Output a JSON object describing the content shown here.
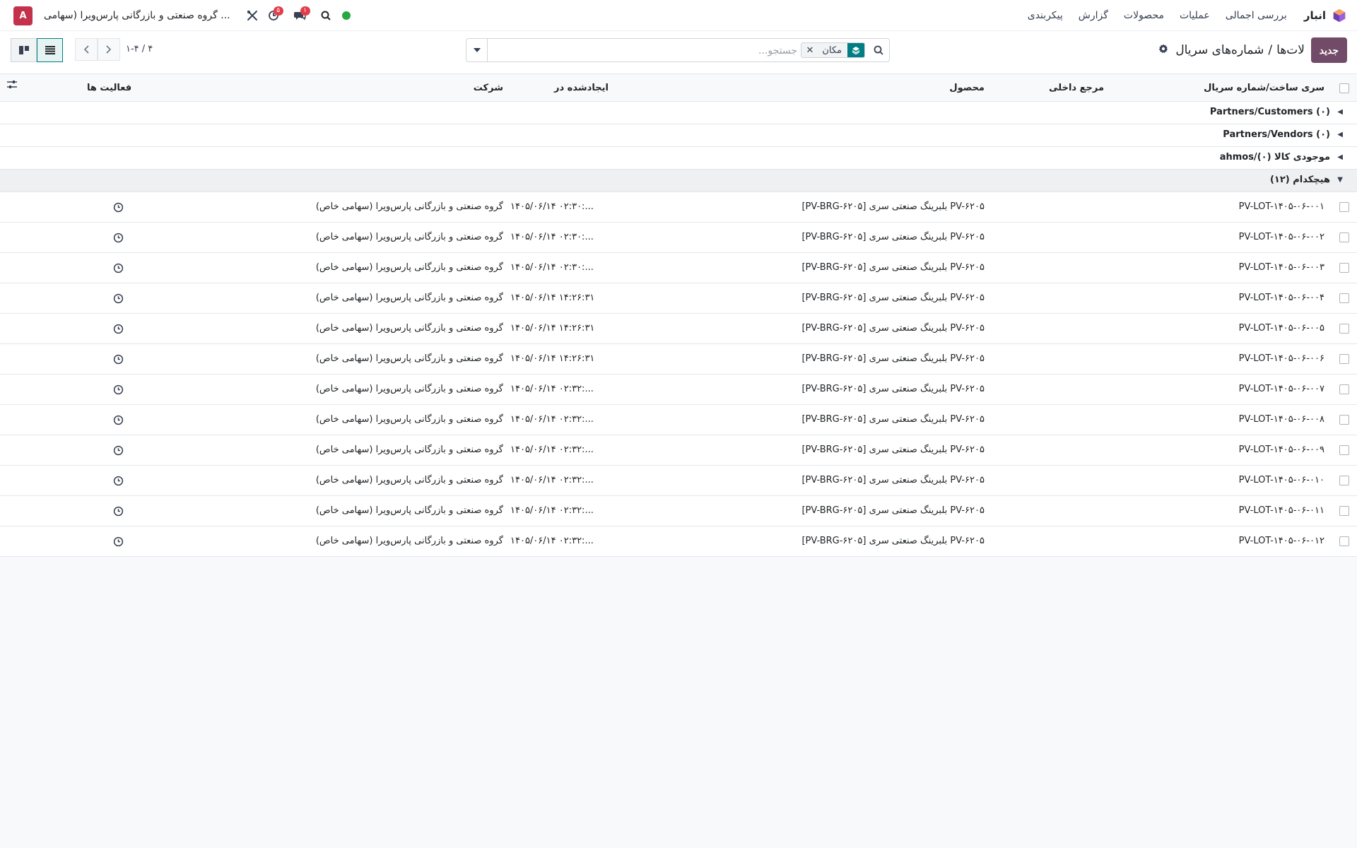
{
  "topbar": {
    "app_name": "انبار",
    "menu": [
      "بررسی اجمالی",
      "عملیات",
      "محصولات",
      "گزارش",
      "پیکربندی"
    ],
    "company": "گروه صنعتی و بازرگانی پارس‌ویرا (سهامی ...",
    "avatar_letter": "A",
    "activity_badge": "۵",
    "messages_badge": "۱",
    "status_color": "#28a745"
  },
  "control": {
    "new_button": "جدید",
    "breadcrumb_parent": "لات‌ها",
    "breadcrumb_sep": "/",
    "breadcrumb_current": "شماره‌های سریال",
    "search_facet": "مکان",
    "search_placeholder": "جستجو...",
    "pager": "۱-۴ / ۴"
  },
  "table": {
    "headers": {
      "lot": "سری ساخت/شماره سریال",
      "ref": "مرجع داخلی",
      "product": "محصول",
      "created": "ایجادشده در",
      "company": "شرکت",
      "activity": "فعالیت ها"
    },
    "groups": [
      {
        "label": "Partners/Customers (۰)",
        "open": false
      },
      {
        "label": "Partners/Vendors (۰)",
        "open": false
      },
      {
        "label": "ahmos/موجودی کالا (۰)",
        "open": false
      },
      {
        "label": "هیچکدام (۱۲)",
        "open": true
      }
    ],
    "rows": [
      {
        "lot": "PV-LOT-۱۴۰۵-۰۶-۰۰۱",
        "product": "[PV-BRG-۶۲۰۵] بلبرینگ صنعتی سری PV-۶۲۰۵",
        "created": "۱۴۰۵/۰۶/۱۴ ۰۲:۳۰:...",
        "company": "گروه صنعتی و بازرگانی پارس‌ویرا (سهامی خاص)"
      },
      {
        "lot": "PV-LOT-۱۴۰۵-۰۶-۰۰۲",
        "product": "[PV-BRG-۶۲۰۵] بلبرینگ صنعتی سری PV-۶۲۰۵",
        "created": "۱۴۰۵/۰۶/۱۴ ۰۲:۳۰:...",
        "company": "گروه صنعتی و بازرگانی پارس‌ویرا (سهامی خاص)"
      },
      {
        "lot": "PV-LOT-۱۴۰۵-۰۶-۰۰۳",
        "product": "[PV-BRG-۶۲۰۵] بلبرینگ صنعتی سری PV-۶۲۰۵",
        "created": "۱۴۰۵/۰۶/۱۴ ۰۲:۳۰:...",
        "company": "گروه صنعتی و بازرگانی پارس‌ویرا (سهامی خاص)"
      },
      {
        "lot": "PV-LOT-۱۴۰۵-۰۶-۰۰۴",
        "product": "[PV-BRG-۶۲۰۵] بلبرینگ صنعتی سری PV-۶۲۰۵",
        "created": "۱۴۰۵/۰۶/۱۴ ۱۴:۲۶:۳۱",
        "company": "گروه صنعتی و بازرگانی پارس‌ویرا (سهامی خاص)"
      },
      {
        "lot": "PV-LOT-۱۴۰۵-۰۶-۰۰۵",
        "product": "[PV-BRG-۶۲۰۵] بلبرینگ صنعتی سری PV-۶۲۰۵",
        "created": "۱۴۰۵/۰۶/۱۴ ۱۴:۲۶:۳۱",
        "company": "گروه صنعتی و بازرگانی پارس‌ویرا (سهامی خاص)"
      },
      {
        "lot": "PV-LOT-۱۴۰۵-۰۶-۰۰۶",
        "product": "[PV-BRG-۶۲۰۵] بلبرینگ صنعتی سری PV-۶۲۰۵",
        "created": "۱۴۰۵/۰۶/۱۴ ۱۴:۲۶:۳۱",
        "company": "گروه صنعتی و بازرگانی پارس‌ویرا (سهامی خاص)"
      },
      {
        "lot": "PV-LOT-۱۴۰۵-۰۶-۰۰۷",
        "product": "[PV-BRG-۶۲۰۵] بلبرینگ صنعتی سری PV-۶۲۰۵",
        "created": "۱۴۰۵/۰۶/۱۴ ۰۲:۳۲:...",
        "company": "گروه صنعتی و بازرگانی پارس‌ویرا (سهامی خاص)"
      },
      {
        "lot": "PV-LOT-۱۴۰۵-۰۶-۰۰۸",
        "product": "[PV-BRG-۶۲۰۵] بلبرینگ صنعتی سری PV-۶۲۰۵",
        "created": "۱۴۰۵/۰۶/۱۴ ۰۲:۳۲:...",
        "company": "گروه صنعتی و بازرگانی پارس‌ویرا (سهامی خاص)"
      },
      {
        "lot": "PV-LOT-۱۴۰۵-۰۶-۰۰۹",
        "product": "[PV-BRG-۶۲۰۵] بلبرینگ صنعتی سری PV-۶۲۰۵",
        "created": "۱۴۰۵/۰۶/۱۴ ۰۲:۳۲:...",
        "company": "گروه صنعتی و بازرگانی پارس‌ویرا (سهامی خاص)"
      },
      {
        "lot": "PV-LOT-۱۴۰۵-۰۶-۰۱۰",
        "product": "[PV-BRG-۶۲۰۵] بلبرینگ صنعتی سری PV-۶۲۰۵",
        "created": "۱۴۰۵/۰۶/۱۴ ۰۲:۳۲:...",
        "company": "گروه صنعتی و بازرگانی پارس‌ویرا (سهامی خاص)"
      },
      {
        "lot": "PV-LOT-۱۴۰۵-۰۶-۰۱۱",
        "product": "[PV-BRG-۶۲۰۵] بلبرینگ صنعتی سری PV-۶۲۰۵",
        "created": "۱۴۰۵/۰۶/۱۴ ۰۲:۳۲:...",
        "company": "گروه صنعتی و بازرگانی پارس‌ویرا (سهامی خاص)"
      },
      {
        "lot": "PV-LOT-۱۴۰۵-۰۶-۰۱۲",
        "product": "[PV-BRG-۶۲۰۵] بلبرینگ صنعتی سری PV-۶۲۰۵",
        "created": "۱۴۰۵/۰۶/۱۴ ۰۲:۳۲:...",
        "company": "گروه صنعتی و بازرگانی پارس‌ویرا (سهامی خاص)"
      }
    ]
  },
  "icons": {
    "app": "inventory-cube-icon",
    "search": "search-icon",
    "tools": "tools-icon",
    "activity": "clock-icon",
    "messages": "chat-icon",
    "gear": "gear-icon",
    "list_view": "list-view-icon",
    "kanban_view": "kanban-view-icon",
    "optional_columns": "sliders-icon"
  },
  "colors": {
    "brand": "#714b67",
    "accent": "#017e84"
  }
}
